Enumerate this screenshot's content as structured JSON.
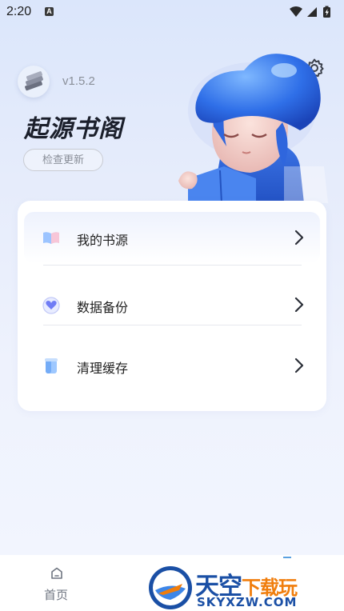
{
  "status_bar": {
    "time": "2:20",
    "notification_letter": "A"
  },
  "header": {
    "version": "v1.5.2",
    "title": "起源书阁",
    "check_update_label": "检查更新"
  },
  "menu": {
    "items": [
      {
        "label": "我的书源",
        "icon": "book-source-icon"
      },
      {
        "label": "数据备份",
        "icon": "backup-icon"
      },
      {
        "label": "清理缓存",
        "icon": "clear-cache-icon"
      }
    ]
  },
  "bottom_nav": {
    "home_label": "首页"
  },
  "watermark": {
    "title_main": "天空",
    "title_accent": "下载玩",
    "url": "SKYXZW.COM"
  },
  "colors": {
    "accent_blue": "#3d7cf0",
    "title_dark": "#1b1f2b",
    "muted": "#8a8f99"
  }
}
